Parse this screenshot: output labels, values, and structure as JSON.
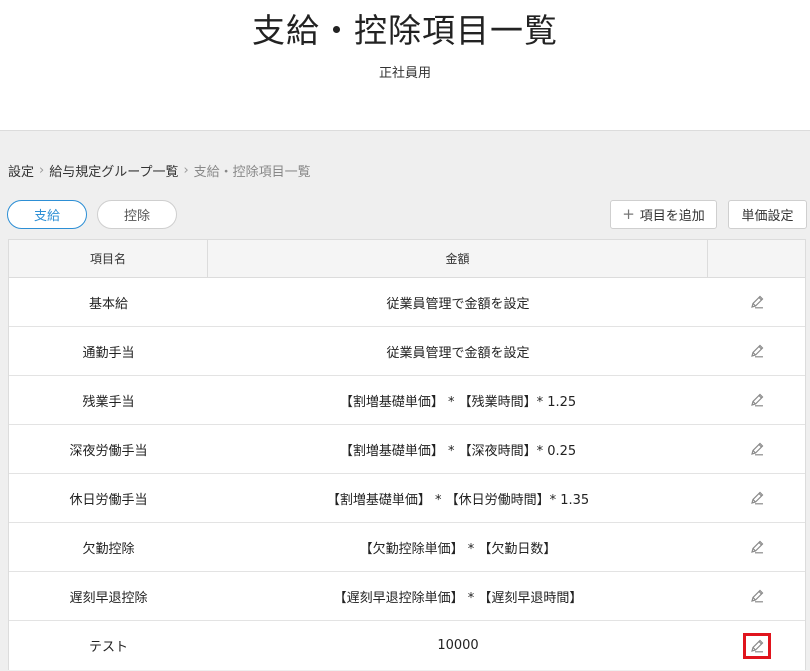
{
  "header": {
    "title": "支給・控除項目一覧",
    "subtitle": "正社員用"
  },
  "breadcrumb": {
    "items": [
      "設定",
      "給与規定グループ一覧",
      "支給・控除項目一覧"
    ],
    "separator": "›"
  },
  "tabs": [
    {
      "label": "支給",
      "active": true
    },
    {
      "label": "控除",
      "active": false
    }
  ],
  "toolbar": {
    "add_label": "項目を追加",
    "add_icon": "plus-icon",
    "unit_price_label": "単価設定"
  },
  "table": {
    "columns": [
      "項目名",
      "金額",
      ""
    ],
    "rows": [
      {
        "name": "基本給",
        "amount": "従業員管理で金額を設定"
      },
      {
        "name": "通勤手当",
        "amount": "従業員管理で金額を設定"
      },
      {
        "name": "残業手当",
        "amount": "【割増基礎単価】 * 【残業時間】* 1.25"
      },
      {
        "name": "深夜労働手当",
        "amount": "【割増基礎単価】 * 【深夜時間】* 0.25"
      },
      {
        "name": "休日労働手当",
        "amount": "【割増基礎単価】 * 【休日労働時間】* 1.35"
      },
      {
        "name": "欠勤控除",
        "amount": "【欠勤控除単価】 * 【欠勤日数】"
      },
      {
        "name": "遅刻早退控除",
        "amount": "【遅刻早退控除単価】 * 【遅刻早退時間】"
      },
      {
        "name": "テスト",
        "amount": "10000"
      }
    ],
    "edit_icon": "pencil-icon",
    "highlighted_row": 7
  },
  "colors": {
    "accent": "#2d8fd5",
    "highlight": "#e0141d",
    "background": "#efefef"
  }
}
